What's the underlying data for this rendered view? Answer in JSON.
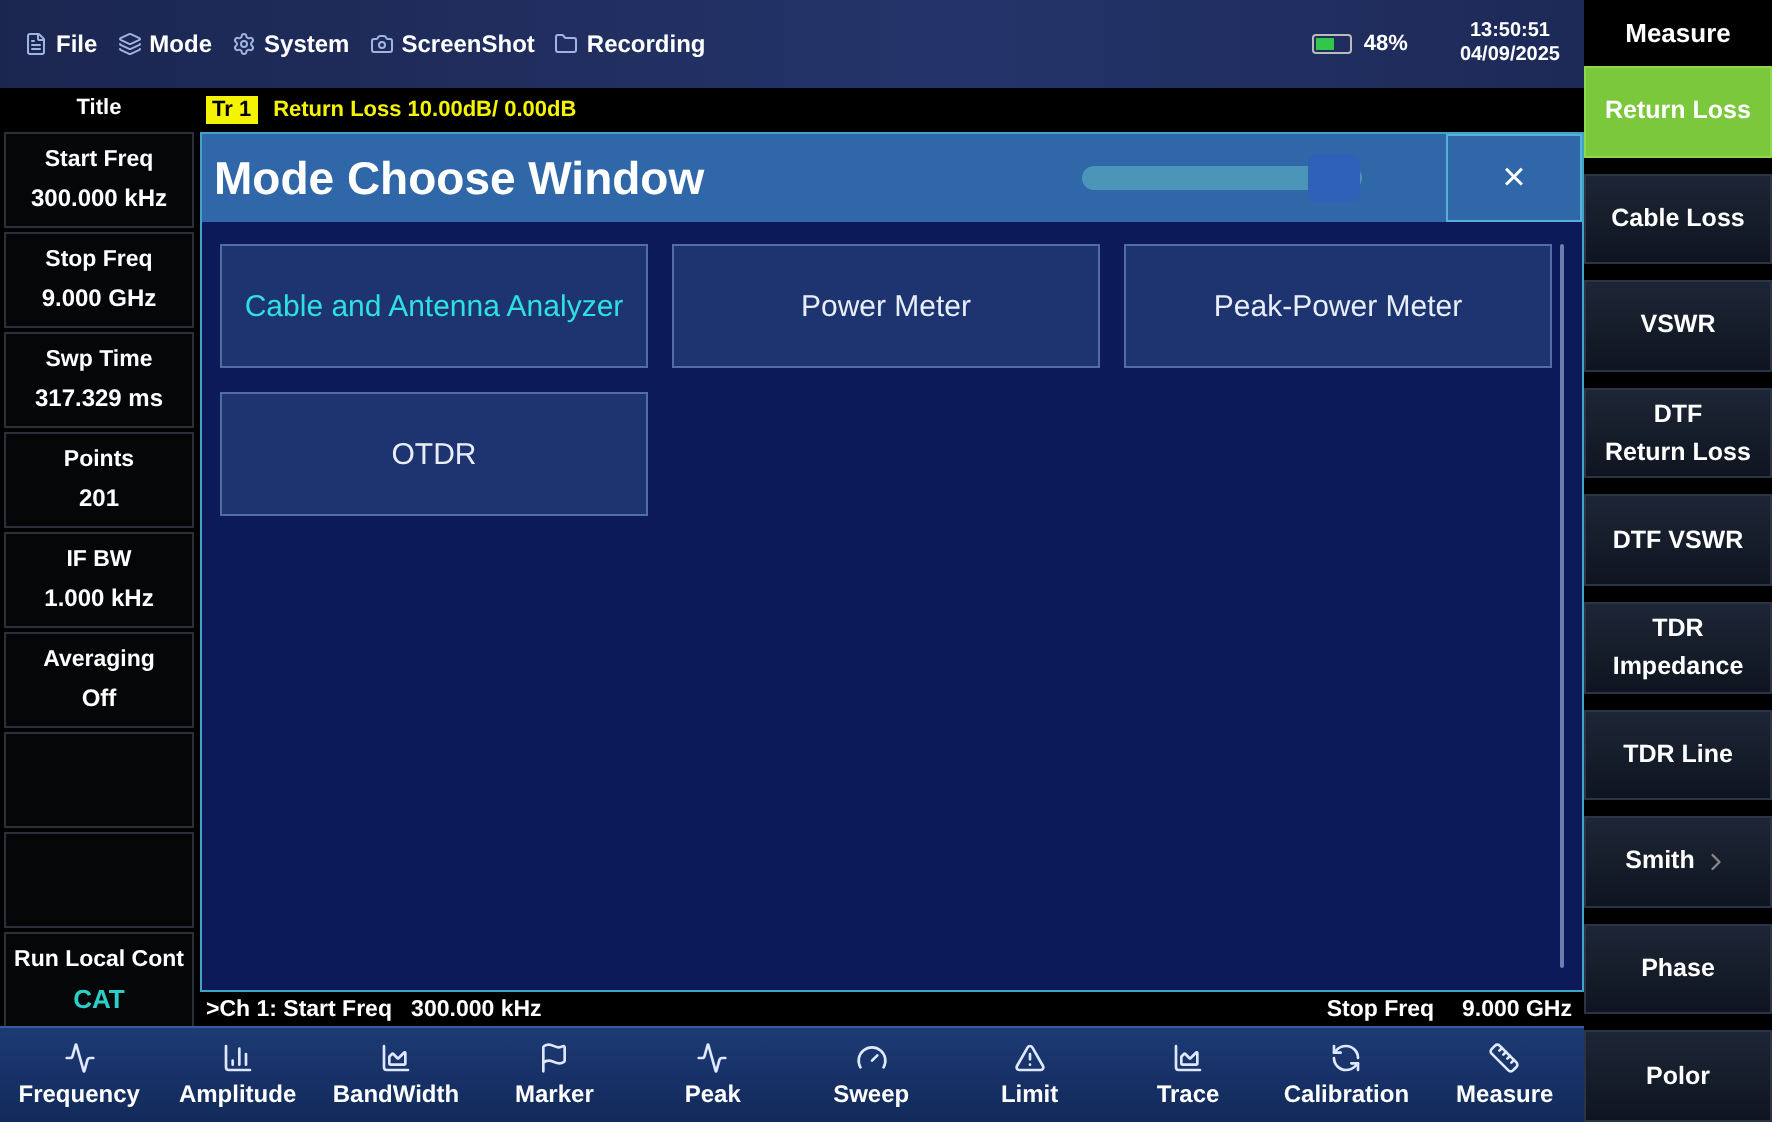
{
  "menu": [
    "File",
    "Mode",
    "System",
    "ScreenShot",
    "Recording"
  ],
  "status": {
    "battery": "48%",
    "time": "13:50:51",
    "date": "04/09/2025"
  },
  "left_panel": {
    "title": "Title",
    "params": [
      {
        "label": "Start Freq",
        "value": "300.000 kHz",
        "kind": "normal"
      },
      {
        "label": "Stop Freq",
        "value": "9.000 GHz",
        "kind": "normal"
      },
      {
        "label": "Swp Time",
        "value": "317.329 ms",
        "kind": "normal"
      },
      {
        "label": "Points",
        "value": "201",
        "kind": "normal"
      },
      {
        "label": "IF BW",
        "value": "1.000 kHz",
        "kind": "normal"
      },
      {
        "label": "Averaging",
        "value": "Off",
        "kind": "normal"
      },
      {
        "kind": "blank"
      },
      {
        "kind": "blank"
      },
      {
        "label": "Run Local Cont",
        "value": "CAT",
        "kind": "accent"
      }
    ]
  },
  "trace": {
    "badge": "Tr 1",
    "text": "Return Loss 10.00dB/ 0.00dB"
  },
  "dialog": {
    "title": "Mode Choose Window",
    "slider": {
      "level": 0.9
    },
    "close": "×",
    "modes": [
      {
        "label": "Cable and Antenna Analyzer",
        "selected": true
      },
      {
        "label": "Power Meter",
        "selected": false
      },
      {
        "label": "Peak-Power Meter",
        "selected": false
      },
      {
        "label": "OTDR",
        "selected": false
      }
    ]
  },
  "channel_bar": {
    "start": ">Ch 1: Start Freq   300.000 kHz",
    "stop_label": "Stop Freq",
    "stop_value": "9.000 GHz"
  },
  "toolbar": [
    "Frequency",
    "Amplitude",
    "BandWidth",
    "Marker",
    "Peak",
    "Sweep",
    "Limit",
    "Trace",
    "Calibration",
    "Measure"
  ],
  "softkeys": {
    "title": "Measure",
    "items": [
      {
        "label": "Return Loss",
        "selected": true,
        "submenu": false
      },
      {
        "label": "Cable Loss",
        "selected": false,
        "submenu": false
      },
      {
        "label": "VSWR",
        "selected": false,
        "submenu": false
      },
      {
        "label": "DTF\nReturn Loss",
        "selected": false,
        "submenu": false
      },
      {
        "label": "DTF VSWR",
        "selected": false,
        "submenu": false
      },
      {
        "label": "TDR\nImpedance",
        "selected": false,
        "submenu": false
      },
      {
        "label": "TDR Line",
        "selected": false,
        "submenu": false
      },
      {
        "label": "Smith",
        "selected": false,
        "submenu": true
      },
      {
        "label": "Phase",
        "selected": false,
        "submenu": false
      },
      {
        "label": "Polor",
        "selected": false,
        "submenu": false
      }
    ]
  }
}
